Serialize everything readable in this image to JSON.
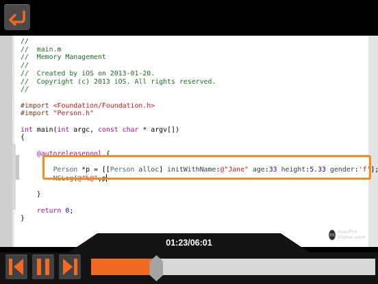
{
  "toolbar": {
    "back_icon": "back-arrow-icon",
    "accent": "#f26a21"
  },
  "code_lines": [
    "//",
    "//  main.m",
    "//  Memory Management",
    "//",
    "//  Created by iOS on 2013-01-20.",
    "//  Copyright (c) 2013 iOS. All rights reserved.",
    "//",
    "",
    "#import <Foundation/Foundation.h>",
    "#import \"Person.h\"",
    "",
    "int main(int argc, const char * argv[])",
    "{",
    "",
    "    @autoreleasepool {",
    "",
    "        Person *p = [[Person alloc] initWithName:@\"Jane\" age:33 height:5.33 gender:'f'];",
    "        NSLog(@\"%@\",p",
    "",
    "    }",
    "",
    "    return 0;",
    "}"
  ],
  "watermark": {
    "line1": "macPro",
    "line2": "Video.com"
  },
  "player": {
    "time": "01:23/06:01",
    "progress": 0.23,
    "buttons": [
      "skip-back-icon",
      "pause-icon",
      "skip-forward-icon"
    ]
  }
}
